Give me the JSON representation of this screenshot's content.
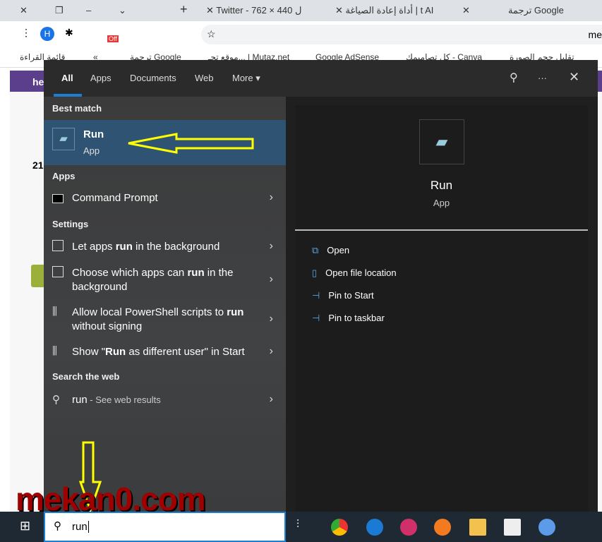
{
  "browser": {
    "tabs": [
      "Twitter - 762 × 440 ل",
      "أداة إعادة الصياغة | t AI",
      "ترجمة Google"
    ],
    "address_partial": "me",
    "bookmarks": [
      "قائمة القراءة",
      "ترجمة Google",
      "موقع تحـ... | Mutaz.net",
      "Google AdSense",
      "كل تصاميمك - Canva",
      "تقليل حجم الصورة"
    ],
    "ext_badge": "Off",
    "profile_initial": "H",
    "purple_text": "he",
    "page_number": "21"
  },
  "search": {
    "tabs": [
      "All",
      "Apps",
      "Documents",
      "Web",
      "More ▾"
    ],
    "best_match_header": "Best match",
    "best": {
      "title": "Run",
      "subtitle": "App"
    },
    "apps_header": "Apps",
    "apps": [
      {
        "label": "Command Prompt"
      }
    ],
    "settings_header": "Settings",
    "settings": [
      {
        "pre": "Let apps ",
        "bold": "run",
        "post": " in the background"
      },
      {
        "pre": "Choose which apps can ",
        "bold": "run",
        "post": " in the background"
      },
      {
        "pre": "Allow local PowerShell scripts to ",
        "bold": "run",
        "post": " without signing"
      },
      {
        "pre": "Show \"",
        "bold": "Run",
        "post": " as different user\" in Start"
      }
    ],
    "web_header": "Search the web",
    "web": {
      "query": "run",
      "suffix": " - See web results"
    },
    "preview": {
      "title": "Run",
      "subtitle": "App"
    },
    "actions": [
      "Open",
      "Open file location",
      "Pin to Start",
      "Pin to taskbar"
    ],
    "query": "run"
  },
  "watermark": "mekan0.com",
  "colors": {
    "accent": "#1c7fd0",
    "selected": "#2f5473",
    "annotation": "#ffff00"
  }
}
